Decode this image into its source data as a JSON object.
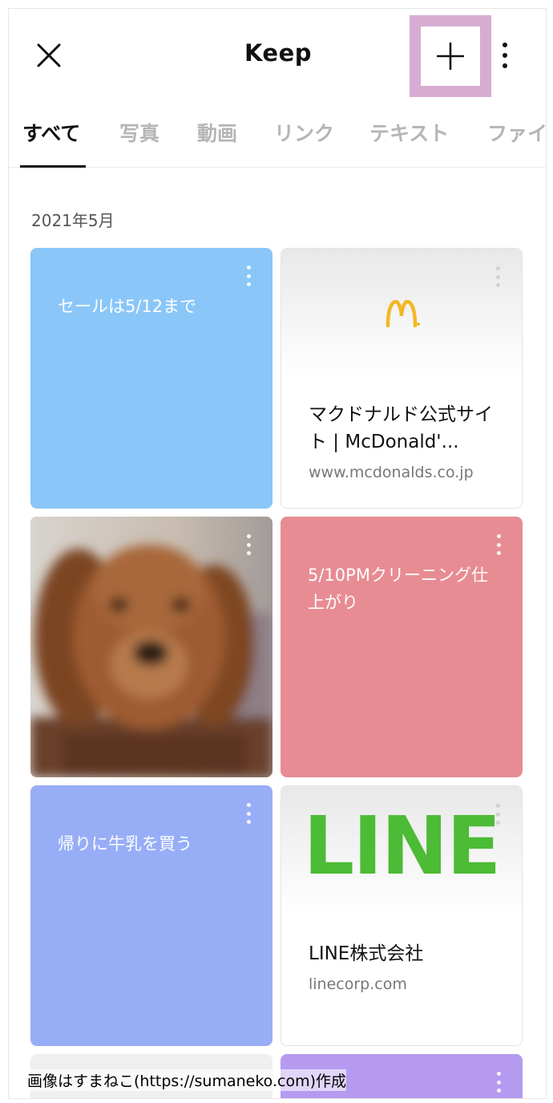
{
  "header": {
    "title": "Keep",
    "close_icon": "close-icon",
    "add_icon": "plus-icon",
    "more_icon": "more-vertical-icon",
    "highlight_color": "#d7acd2"
  },
  "tabs": [
    {
      "label": "すべて",
      "active": true
    },
    {
      "label": "写真",
      "active": false
    },
    {
      "label": "動画",
      "active": false
    },
    {
      "label": "リンク",
      "active": false
    },
    {
      "label": "テキスト",
      "active": false
    },
    {
      "label": "ファイ",
      "active": false
    }
  ],
  "section": {
    "date": "2021年5月"
  },
  "cards": {
    "note1": {
      "text": "セールは5/12まで",
      "color": "#8ac6f8"
    },
    "mcd": {
      "title": "マクドナルド公式サイト | McDonald'...",
      "url": "www.mcdonalds.co.jp",
      "logo": "M"
    },
    "photo": {
      "subject": "dog-photo"
    },
    "note2": {
      "text": "5/10PMクリーニング仕上がり",
      "color": "#e88c93"
    },
    "note3": {
      "text": "帰りに牛乳を買う",
      "color": "#97aef7"
    },
    "line": {
      "logo": "LINE",
      "title": "LINE株式会社",
      "url": "linecorp.com",
      "logo_color": "#4cbb35"
    },
    "bottom_left": {
      "color": "#efefef"
    },
    "bottom_right": {
      "color": "#b59af0"
    }
  },
  "watermark": "画像はすまねこ(https://sumaneko.com)作成"
}
